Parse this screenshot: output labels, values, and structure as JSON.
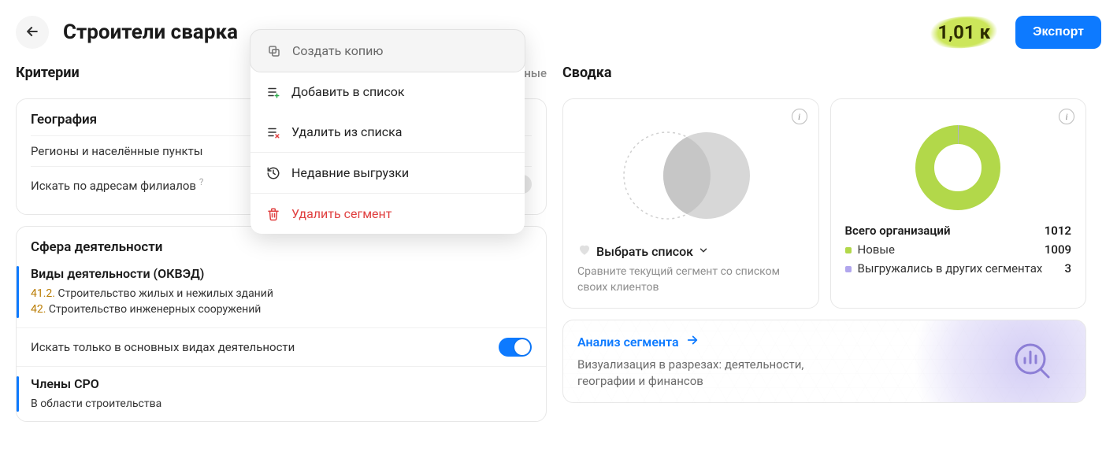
{
  "header": {
    "title": "Строители сварка",
    "count": "1,01 к",
    "export": "Экспорт"
  },
  "menu": {
    "create_copy": "Создать копию",
    "add_to_list": "Добавить в список",
    "remove_from_list": "Удалить из списка",
    "recent_exports": "Недавние выгрузки",
    "delete_segment": "Удалить сегмент"
  },
  "criteria": {
    "heading": "Критерии",
    "changed_suffix": "менённые",
    "geography": {
      "title": "География",
      "regions": "Регионы и населённые пункты",
      "branches": "Искать по адресам филиалов"
    },
    "activity": {
      "title": "Сфера деятельности",
      "okved_title": "Виды деятельности (ОКВЭД)",
      "okved": [
        {
          "code": "41.2.",
          "name": "Строительство жилых и нежилых зданий"
        },
        {
          "code": "42.",
          "name": "Строительство инженерных сооружений"
        }
      ],
      "only_main": "Искать только в основных видах деятельности",
      "sro_title": "Члены СРО",
      "sro_detail": "В области строительства"
    }
  },
  "summary": {
    "heading": "Сводка",
    "choose_list": "Выбрать список",
    "compare": "Сравните текущий сегмент со списком своих клиентов",
    "total_orgs_label": "Всего организаций",
    "total_orgs_value": "1012",
    "new_label": "Новые",
    "new_value": "1009",
    "exported_label": "Выгружались в других сегментах",
    "exported_value": "3",
    "analysis_title": "Анализ сегмента",
    "analysis_sub": "Визуализация в разрезах: деятельности, географии и финансов"
  },
  "chart_data": {
    "type": "pie",
    "title": "Всего организаций",
    "series": [
      {
        "name": "Новые",
        "value": 1009,
        "color": "#b2d84a"
      },
      {
        "name": "Выгружались в других сегментах",
        "value": 3,
        "color": "#b1a6ed"
      }
    ],
    "total": 1012
  }
}
